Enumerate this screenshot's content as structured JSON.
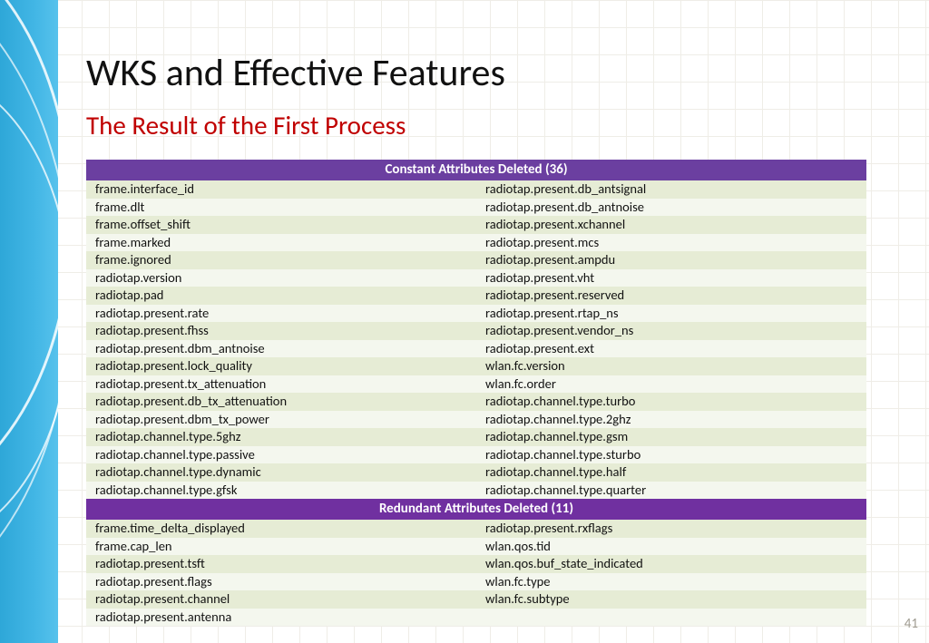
{
  "title": "WKS and Effective Features",
  "subtitle": "The Result of the First Process",
  "page_number": "41",
  "tables": [
    {
      "header": "Constant Attributes Deleted (36)",
      "rows": [
        [
          "frame.interface_id",
          "radiotap.present.db_antsignal"
        ],
        [
          "frame.dlt",
          "radiotap.present.db_antnoise"
        ],
        [
          "frame.offset_shift",
          "radiotap.present.xchannel"
        ],
        [
          "frame.marked",
          "radiotap.present.mcs"
        ],
        [
          "frame.ignored",
          "radiotap.present.ampdu"
        ],
        [
          "radiotap.version",
          "radiotap.present.vht"
        ],
        [
          "radiotap.pad",
          "radiotap.present.reserved"
        ],
        [
          "radiotap.present.rate",
          "radiotap.present.rtap_ns"
        ],
        [
          "radiotap.present.fhss",
          "radiotap.present.vendor_ns"
        ],
        [
          "radiotap.present.dbm_antnoise",
          "radiotap.present.ext"
        ],
        [
          "radiotap.present.lock_quality",
          "wlan.fc.version"
        ],
        [
          "radiotap.present.tx_attenuation",
          "wlan.fc.order"
        ],
        [
          "radiotap.present.db_tx_attenuation",
          "radiotap.channel.type.turbo"
        ],
        [
          "radiotap.present.dbm_tx_power",
          "radiotap.channel.type.2ghz"
        ],
        [
          "radiotap.channel.type.5ghz",
          "radiotap.channel.type.gsm"
        ],
        [
          "radiotap.channel.type.passive",
          "radiotap.channel.type.sturbo"
        ],
        [
          "radiotap.channel.type.dynamic",
          "radiotap.channel.type.half"
        ],
        [
          "radiotap.channel.type.gfsk",
          "radiotap.channel.type.quarter"
        ]
      ]
    },
    {
      "header": "Redundant Attributes Deleted (11)",
      "rows": [
        [
          "frame.time_delta_displayed",
          "radiotap.present.rxflags"
        ],
        [
          "frame.cap_len",
          "wlan.qos.tid"
        ],
        [
          "radiotap.present.tsft",
          "wlan.qos.buf_state_indicated"
        ],
        [
          "radiotap.present.flags",
          "wlan.fc.type"
        ],
        [
          "radiotap.present.channel",
          "wlan.fc.subtype"
        ],
        [
          "radiotap.present.antenna",
          ""
        ]
      ]
    }
  ]
}
